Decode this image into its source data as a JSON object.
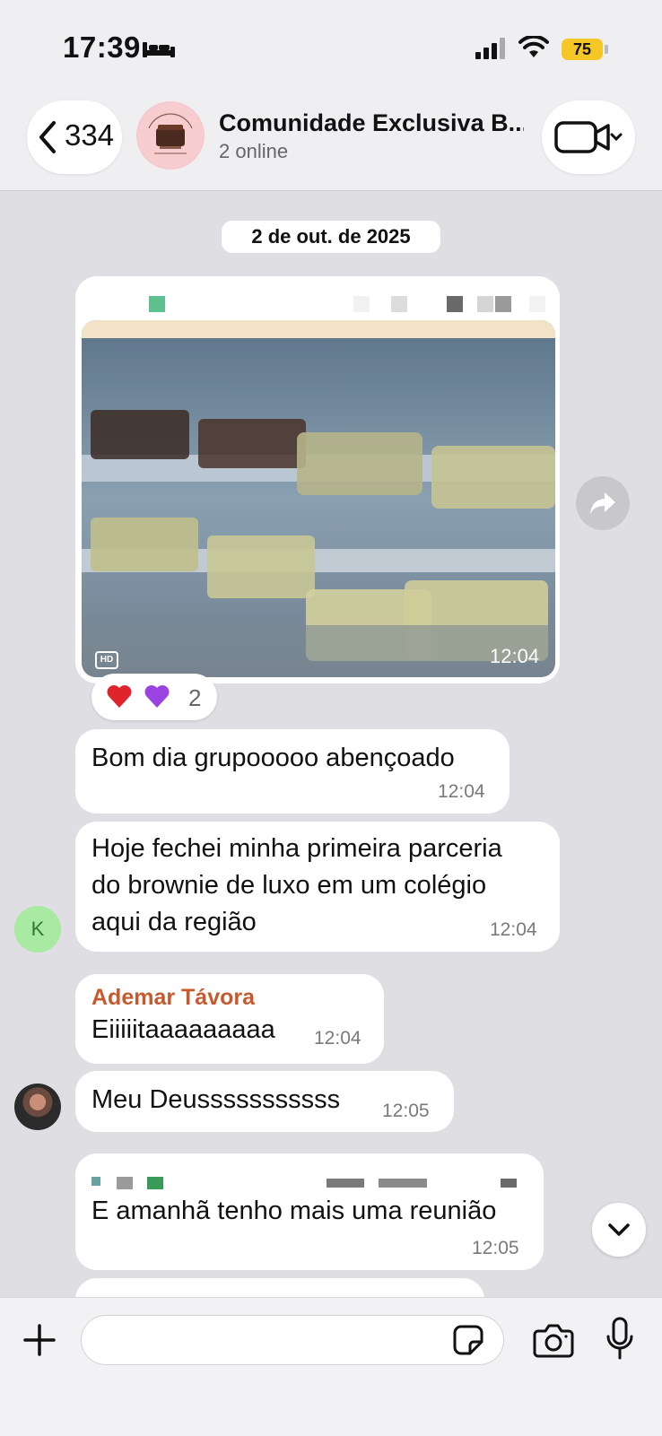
{
  "status": {
    "time": "17:39",
    "battery": "75"
  },
  "header": {
    "back_count": "334",
    "title": "Comunidade Exclusiva B...",
    "subtitle": "2 online"
  },
  "date_separator": "2 de out. de 2025",
  "messages": {
    "image": {
      "time": "12:04",
      "hd": "HD"
    },
    "reactions": {
      "emojis": [
        "❤️",
        "💜"
      ],
      "count": "2"
    },
    "m1": {
      "text": "Bom dia grupooooo abençoado",
      "time": "12:04"
    },
    "m2": {
      "lines": [
        "Hoje fechei minha primeira parceria",
        "do brownie de luxo em um colégio",
        "aqui da região"
      ],
      "time": "12:04",
      "avatar": "K"
    },
    "m3": {
      "sender": "Ademar Távora",
      "text": "Eiiiiitaaaaaaaaa",
      "time": "12:04"
    },
    "m4": {
      "text": "Meu Deusssssssssss",
      "time": "12:05"
    },
    "m5": {
      "text": "E amanhã tenho mais uma reunião",
      "time": "12:05"
    }
  },
  "colors": {
    "accent_sender": "#c65a2e",
    "avatar_k_bg": "#a9eaa2",
    "battery": "#f4c727"
  },
  "icons": [
    "bed-icon",
    "signal-icon",
    "wifi-icon",
    "back-chevron-icon",
    "video-camera-icon",
    "share-icon",
    "scroll-down-icon",
    "plus-icon",
    "sticker-icon",
    "camera-icon",
    "mic-icon"
  ]
}
